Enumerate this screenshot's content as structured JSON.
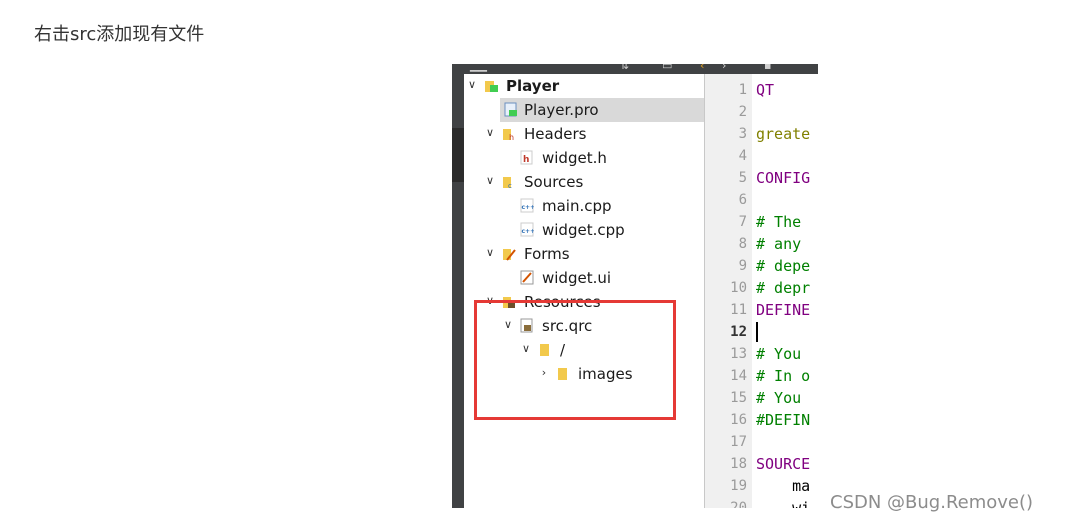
{
  "caption": "右击src添加现有文件",
  "watermark": "CSDN @Bug.Remove()",
  "colors": {
    "highlight_box": "#e53935",
    "keyword_purple": "#800080",
    "comment_green": "#008000",
    "greater_olive": "#808000",
    "selected_row": "#d9d9d9",
    "sidebar_dark": "#404244"
  },
  "project_tree": {
    "root": {
      "label": "Player",
      "icon": "qt-project-icon"
    },
    "items": [
      {
        "label": "Player.pro",
        "icon": "pro-file-icon",
        "selected": true
      },
      {
        "label": "Headers",
        "icon": "folder-headers-icon"
      },
      {
        "label": "widget.h",
        "icon": "header-file-icon"
      },
      {
        "label": "Sources",
        "icon": "folder-sources-icon"
      },
      {
        "label": "main.cpp",
        "icon": "cpp-file-icon"
      },
      {
        "label": "widget.cpp",
        "icon": "cpp-file-icon"
      },
      {
        "label": "Forms",
        "icon": "folder-forms-icon"
      },
      {
        "label": "widget.ui",
        "icon": "ui-file-icon"
      },
      {
        "label": "Resources",
        "icon": "folder-resources-icon"
      },
      {
        "label": "src.qrc",
        "icon": "qrc-file-icon"
      },
      {
        "label": "/",
        "icon": "folder-icon"
      },
      {
        "label": "images",
        "icon": "folder-icon"
      }
    ]
  },
  "editor": {
    "current_line": "12",
    "lines": [
      {
        "n": "1",
        "text": "QT"
      },
      {
        "n": "2",
        "text": ""
      },
      {
        "n": "3",
        "text": "greate"
      },
      {
        "n": "4",
        "text": ""
      },
      {
        "n": "5",
        "text": "CONFIG"
      },
      {
        "n": "6",
        "text": ""
      },
      {
        "n": "7",
        "text": "# The"
      },
      {
        "n": "8",
        "text": "# any"
      },
      {
        "n": "9",
        "text": "# depe"
      },
      {
        "n": "10",
        "text": "# depr"
      },
      {
        "n": "11",
        "text": "DEFINE"
      },
      {
        "n": "12",
        "text": ""
      },
      {
        "n": "13",
        "text": "# You"
      },
      {
        "n": "14",
        "text": "# In o"
      },
      {
        "n": "15",
        "text": "# You"
      },
      {
        "n": "16",
        "text": "#DEFIN"
      },
      {
        "n": "17",
        "text": ""
      },
      {
        "n": "18",
        "text": "SOURCE"
      },
      {
        "n": "19",
        "text": "    ma"
      },
      {
        "n": "20",
        "text": "    wi"
      }
    ]
  }
}
